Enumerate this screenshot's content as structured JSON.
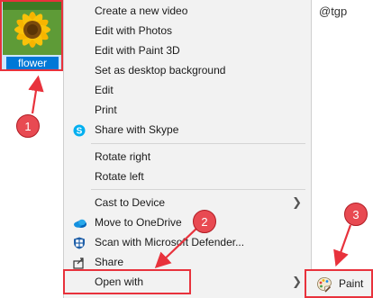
{
  "file": {
    "name": "flower"
  },
  "watermark": "@tgp",
  "menu": {
    "items": [
      {
        "label": "Create a new video"
      },
      {
        "label": "Edit with Photos"
      },
      {
        "label": "Edit with Paint 3D"
      },
      {
        "label": "Set as desktop background"
      },
      {
        "label": "Edit"
      },
      {
        "label": "Print"
      },
      {
        "label": "Share with Skype",
        "icon": "skype-icon"
      },
      {
        "label": "Rotate right"
      },
      {
        "label": "Rotate left"
      },
      {
        "label": "Cast to Device",
        "submenu": true
      },
      {
        "label": "Move to OneDrive",
        "icon": "onedrive-icon"
      },
      {
        "label": "Scan with Microsoft Defender...",
        "icon": "defender-shield-icon"
      },
      {
        "label": "Share",
        "icon": "share-icon"
      },
      {
        "label": "Open with",
        "submenu": true
      }
    ]
  },
  "submenu": {
    "paint_label": "Paint",
    "icon": "paint-palette-icon"
  },
  "callouts": {
    "one": "1",
    "two": "2",
    "three": "3"
  },
  "colors": {
    "highlight": "#e8323c",
    "badge": "#e84a52",
    "selection": "#0078d7"
  }
}
